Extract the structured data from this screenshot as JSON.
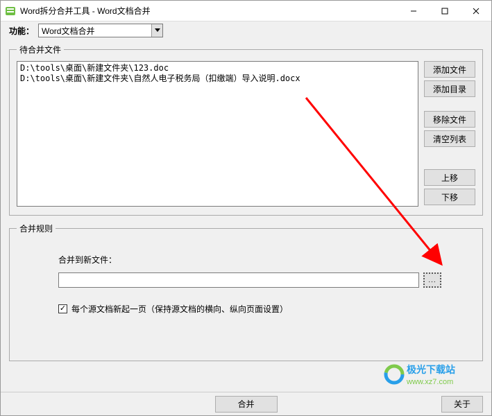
{
  "window": {
    "title": "Word拆分合并工具 - Word文档合并"
  },
  "toolbar": {
    "function_label": "功能：",
    "function_value": "Word文档合并"
  },
  "files_group": {
    "legend": "待合并文件",
    "items": [
      "D:\\tools\\桌面\\新建文件夹\\123.doc",
      "D:\\tools\\桌面\\新建文件夹\\自然人电子税务局（扣缴端）导入说明.docx"
    ],
    "buttons": {
      "add_file": "添加文件",
      "add_folder": "添加目录",
      "remove_file": "移除文件",
      "clear_list": "清空列表",
      "move_up": "上移",
      "move_down": "下移"
    }
  },
  "rules_group": {
    "legend": "合并规则",
    "output_label": "合并到新文件：",
    "output_value": "",
    "browse_label": "...",
    "checkbox_checked": true,
    "checkbox_label": "每个源文档新起一页（保持源文档的横向、纵向页面设置）"
  },
  "bottom": {
    "merge_label": "合并",
    "about_label": "关于"
  },
  "watermark": {
    "text": "极光下载站",
    "url": "www.xz7.com"
  }
}
